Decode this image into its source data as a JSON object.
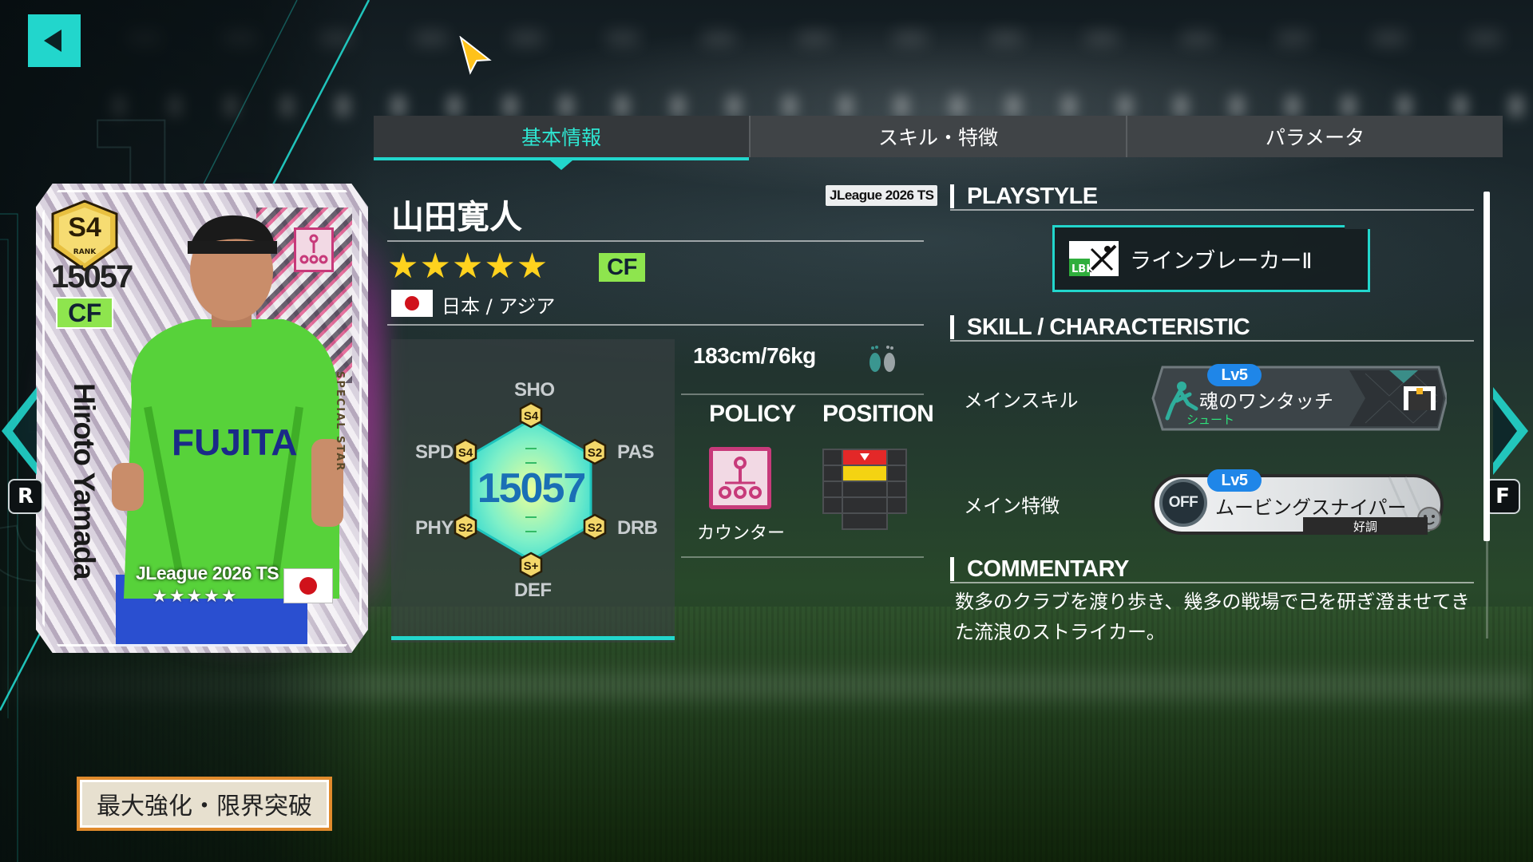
{
  "tabs": [
    {
      "label": "基本情報",
      "active": true
    },
    {
      "label": "スキル・特徴",
      "active": false
    },
    {
      "label": "パラメータ",
      "active": false
    }
  ],
  "card": {
    "rank": "S4",
    "rank_label": "RANK",
    "rating": "15057",
    "position": "CF",
    "name": "Hiroto Yamada",
    "special": "SPECIAL STAR",
    "set": "JLeague 2026 TS",
    "stars": "★★★★★",
    "sponsor": "FUJITA"
  },
  "player": {
    "name": "山田寛人",
    "set_badge": "JLeague 2026 TS",
    "stars": "★★★★★",
    "position": "CF",
    "nationality": "日本 / アジア",
    "body": "183cm/76kg"
  },
  "stats": {
    "overall": "15057",
    "labels": {
      "sho": "SHO",
      "pas": "PAS",
      "drb": "DRB",
      "def": "DEF",
      "phy": "PHY",
      "spd": "SPD"
    },
    "grades": {
      "sho": "S4",
      "pas": "S2",
      "drb": "S2",
      "def": "S+",
      "phy": "S2",
      "spd": "S4"
    }
  },
  "policy": {
    "header": "POLICY",
    "label": "カウンター"
  },
  "position_map": {
    "header": "POSITION"
  },
  "sections": {
    "playstyle": "PLAYSTYLE",
    "skill": "SKILL / CHARACTERISTIC",
    "commentary": "COMMENTARY"
  },
  "playstyle": {
    "code": "LBK",
    "name": "ラインブレーカーⅡ"
  },
  "main_skill": {
    "label": "メインスキル",
    "level": "Lv5",
    "name": "魂のワンタッチ",
    "type": "シュート"
  },
  "main_trait": {
    "label": "メイン特徴",
    "level": "Lv5",
    "name": "ムービングスナイパー",
    "status": "OFF",
    "condition": "好調"
  },
  "commentary": "数多のクラブを渡り歩き、幾多の戦場で己を研ぎ澄ませてきた流浪のストライカー。",
  "buttons": {
    "max": "最大強化・限界突破"
  },
  "nav": {
    "left_key": "R",
    "right_key": "F"
  },
  "colors": {
    "accent": "#22d6cc",
    "position_badge": "#8ee54e",
    "star": "#ffd21e",
    "policy": "#c73a7a"
  }
}
